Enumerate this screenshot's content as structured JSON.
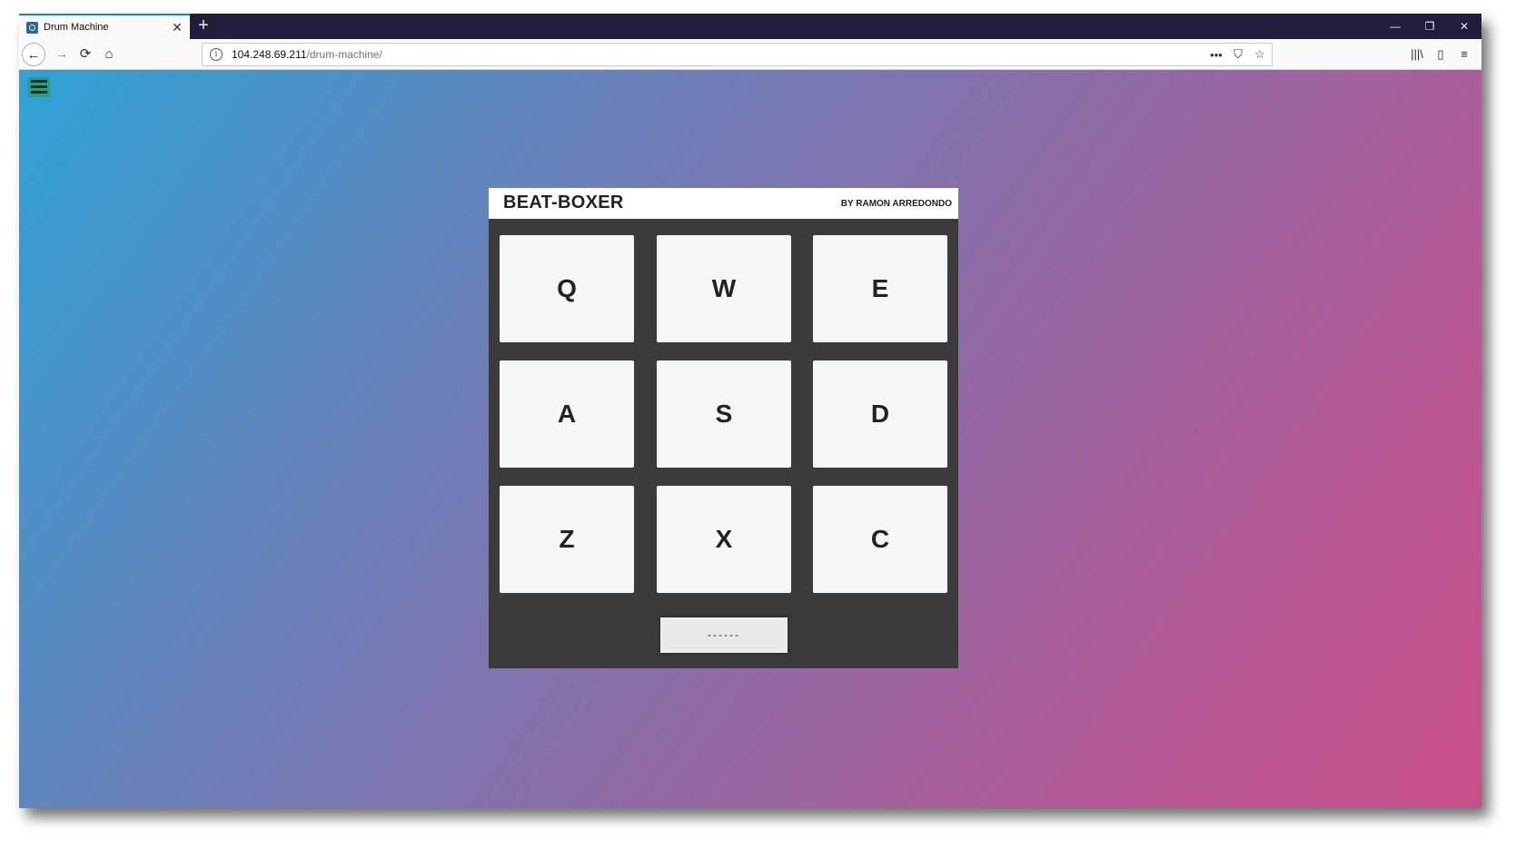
{
  "browser": {
    "tab_title": "Drum Machine",
    "tab_close": "✕",
    "new_tab": "+",
    "window_controls": {
      "minimize": "—",
      "restore": "❐",
      "close": "✕"
    },
    "nav": {
      "back": "←",
      "forward": "→",
      "reload": "⟳",
      "home": "⌂"
    },
    "url_host": "104.248.69.211",
    "url_path": "/drum-machine/",
    "url_actions": {
      "more": "•••",
      "pocket": "⛉",
      "bookmark": "☆"
    },
    "toolbar": {
      "library": "|||\\",
      "sidebar": "▯",
      "menu": "≡"
    }
  },
  "app": {
    "title": "BEAT-BOXER",
    "author": "BY RAMON ARREDONDO",
    "pads": [
      "Q",
      "W",
      "E",
      "A",
      "S",
      "D",
      "Z",
      "X",
      "C"
    ],
    "display_text": "------"
  },
  "colors": {
    "gradient_start": "#2fa2d5",
    "gradient_end": "#c84f8a",
    "machine_bg": "#3b3b3b",
    "pad_bg": "#f5f6f8"
  }
}
